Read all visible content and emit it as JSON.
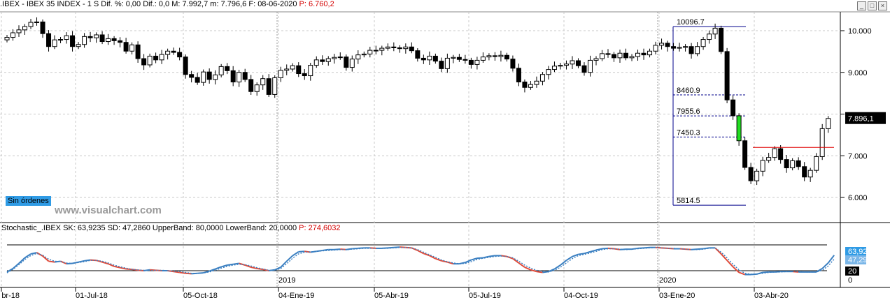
{
  "header": {
    "symbol": ".IBEX - IBEX 35 INDEX - 1 S",
    "dif_pct_label": "Dif. %:",
    "dif_pct": "0,00",
    "dif_label": "Dif.:",
    "dif": "0,0",
    "max_label": "M:",
    "max": "7.992,7",
    "min_label": "m:",
    "min": "7.796,6",
    "date_label": "F:",
    "date": "08-06-2020",
    "p_label": "P:",
    "p": "6.760,2"
  },
  "price_axis": {
    "ticks": [
      "10.000",
      "9.000",
      "8.000",
      "7.000",
      "6.000"
    ],
    "last_price": "7.896,1"
  },
  "fibonacci": {
    "high": "10096.7",
    "l1": "8460.9",
    "l2": "7955.6",
    "l3": "7450.3",
    "low": "5814.5"
  },
  "orders_label": "Sin órdenes",
  "watermark": "www.visualchart.com",
  "stochastic": {
    "title": "Stochastic_.IBEX",
    "sk_label": "SK:",
    "sk": "63,9235",
    "sd_label": "SD:",
    "sd": "47,2860",
    "ub_label": "UpperBand:",
    "ub": "80,0000",
    "lb_label": "LowerBand:",
    "lb": "20,0000",
    "p_label": "P:",
    "p": "274,6032",
    "axis": {
      "sk_value": "63,92",
      "sd_value": "47,29",
      "lower": "20",
      "zero": "0"
    }
  },
  "x_axis": {
    "labels": [
      "br-18",
      "01-Jul-18",
      "05-Oct-18",
      "04-Ene-19",
      "05-Abr-19",
      "05-Jul-19",
      "04-Oct-19",
      "03-Ene-20",
      "03-Abr-20"
    ],
    "years": [
      "2019",
      "2020"
    ]
  },
  "colors": {
    "up": "#ffffff",
    "down": "#000000",
    "sk": "#3a7fc1",
    "sd": "#e04b3a",
    "fib": "#00008b",
    "support": "#e00000",
    "highlight": "#22dd22",
    "label_bg": "#2f9be5"
  },
  "chart_data": {
    "type": "candlestick",
    "title": ".IBEX - IBEX 35 INDEX - 1 S",
    "ylim": [
      5600,
      10400
    ],
    "y_ticks": [
      10000,
      9000,
      8000,
      7000,
      6000
    ],
    "support_level": 7200,
    "fibonacci_levels": [
      10096.7,
      8460.9,
      7955.6,
      7450.3,
      5814.5
    ],
    "close": [
      9840,
      9950,
      10020,
      10100,
      10200,
      10210,
      9930,
      9620,
      9780,
      9790,
      9880,
      9620,
      9670,
      9860,
      9830,
      9900,
      9740,
      9810,
      9760,
      9720,
      9510,
      9660,
      9330,
      9180,
      9390,
      9300,
      9430,
      9510,
      9480,
      9370,
      8950,
      8880,
      8760,
      9010,
      8830,
      8940,
      9140,
      9040,
      8770,
      9000,
      8830,
      8540,
      8700,
      8850,
      8470,
      8870,
      9050,
      9080,
      9160,
      8970,
      8920,
      9170,
      9300,
      9260,
      9330,
      9360,
      9370,
      9120,
      9320,
      9420,
      9440,
      9530,
      9530,
      9580,
      9610,
      9590,
      9570,
      9610,
      9520,
      9340,
      9300,
      9390,
      9270,
      9090,
      9340,
      9360,
      9310,
      9290,
      9190,
      9290,
      9370,
      9400,
      9380,
      9410,
      9320,
      9100,
      8770,
      8640,
      8710,
      8790,
      8950,
      9070,
      9150,
      9170,
      9200,
      9280,
      9160,
      9000,
      9290,
      9330,
      9450,
      9430,
      9350,
      9460,
      9350,
      9380,
      9460,
      9420,
      9510,
      9650,
      9700,
      9620,
      9580,
      9600,
      9620,
      9450,
      9620,
      9790,
      9920,
      10060,
      9500,
      8340,
      7960,
      7360,
      6720,
      6400,
      6630,
      6890,
      6960,
      7170,
      6910,
      6710,
      6880,
      6740,
      6490,
      6650,
      6980,
      7650,
      7895
    ],
    "stochastic": {
      "ylim": [
        0,
        100
      ],
      "upper_band": 80,
      "lower_band": 20,
      "sk": [
        17,
        25,
        37,
        50,
        59,
        62,
        54,
        42,
        40,
        42,
        36,
        37,
        40,
        43,
        45,
        44,
        40,
        36,
        30,
        27,
        24,
        23,
        21,
        20,
        22,
        21,
        20,
        20,
        18,
        16,
        14,
        13,
        14,
        15,
        19,
        24,
        29,
        33,
        35,
        37,
        33,
        28,
        25,
        23,
        20,
        22,
        28,
        42,
        55,
        64,
        65,
        63,
        65,
        67,
        69,
        69,
        70,
        69,
        71,
        72,
        73,
        73,
        72,
        72,
        73,
        74,
        75,
        74,
        73,
        67,
        60,
        55,
        48,
        43,
        40,
        36,
        36,
        39,
        45,
        49,
        50,
        53,
        55,
        55,
        53,
        48,
        38,
        28,
        22,
        18,
        16,
        18,
        24,
        33,
        44,
        53,
        58,
        60,
        64,
        68,
        71,
        72,
        71,
        69,
        70,
        70,
        72,
        73,
        74,
        74,
        73,
        72,
        71,
        71,
        70,
        69,
        70,
        71,
        73,
        73,
        59,
        44,
        29,
        16,
        11,
        11,
        12,
        16,
        17,
        17,
        18,
        18,
        18,
        17,
        17,
        17,
        17,
        25,
        38,
        56
      ],
      "sd": [
        15,
        23,
        34,
        46,
        55,
        60,
        56,
        47,
        42,
        41,
        38,
        37,
        39,
        41,
        44,
        44,
        42,
        38,
        33,
        29,
        26,
        23,
        22,
        21,
        21,
        21,
        21,
        20,
        19,
        18,
        16,
        14,
        14,
        15,
        17,
        21,
        26,
        30,
        33,
        35,
        34,
        31,
        27,
        24,
        21,
        21,
        25,
        36,
        49,
        59,
        63,
        64,
        65,
        66,
        67,
        68,
        69,
        69,
        70,
        71,
        72,
        72,
        72,
        72,
        72,
        73,
        74,
        74,
        73,
        69,
        63,
        57,
        51,
        45,
        41,
        38,
        36,
        37,
        41,
        46,
        49,
        51,
        53,
        54,
        53,
        50,
        42,
        33,
        26,
        21,
        18,
        17,
        21,
        28,
        38,
        48,
        55,
        58,
        61,
        65,
        69,
        71,
        71,
        70,
        69,
        70,
        71,
        72,
        73,
        74,
        73,
        72,
        72,
        71,
        70,
        69,
        69,
        70,
        72,
        73,
        63,
        50,
        35,
        22,
        14,
        12,
        12,
        14,
        16,
        17,
        17,
        18,
        18,
        18,
        17,
        17,
        17,
        21,
        31,
        47
      ]
    }
  }
}
